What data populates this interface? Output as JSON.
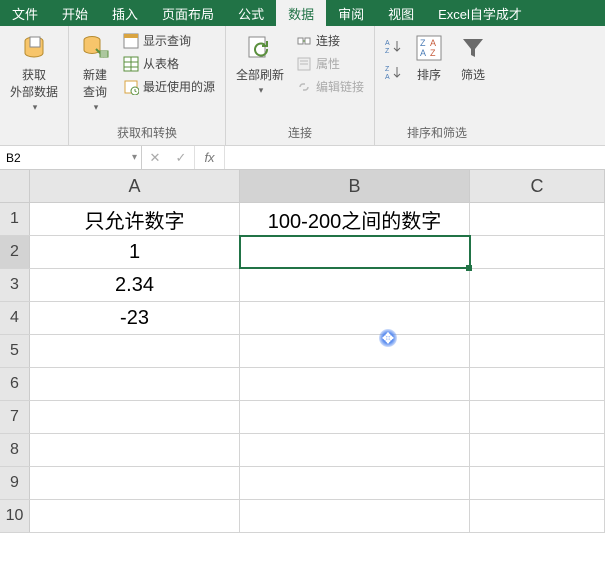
{
  "tabs": {
    "file": "文件",
    "home": "开始",
    "insert": "插入",
    "layout": "页面布局",
    "formulas": "公式",
    "data": "数据",
    "review": "审阅",
    "view": "视图",
    "custom": "Excel自学成才"
  },
  "ribbon": {
    "get_data": "获取\n外部数据",
    "new_query": "新建\n查询",
    "show_queries": "显示查询",
    "from_table": "从表格",
    "recent_sources": "最近使用的源",
    "group_transform": "获取和转换",
    "refresh_all": "全部刷新",
    "connections": "连接",
    "properties": "属性",
    "edit_links": "编辑链接",
    "group_conn": "连接",
    "sort_za": "排序",
    "filter": "筛选",
    "group_sort": "排序和筛选"
  },
  "namebox": "B2",
  "fx": "fx",
  "chart_data": {
    "type": "table",
    "columns": [
      "A",
      "B",
      "C"
    ],
    "rows": [
      {
        "A": "只允许数字",
        "B": "100-200之间的数字",
        "C": ""
      },
      {
        "A": "1",
        "B": "",
        "C": ""
      },
      {
        "A": "2.34",
        "B": "",
        "C": ""
      },
      {
        "A": "-23",
        "B": "",
        "C": ""
      },
      {
        "A": "",
        "B": "",
        "C": ""
      },
      {
        "A": "",
        "B": "",
        "C": ""
      },
      {
        "A": "",
        "B": "",
        "C": ""
      },
      {
        "A": "",
        "B": "",
        "C": ""
      },
      {
        "A": "",
        "B": "",
        "C": ""
      },
      {
        "A": "",
        "B": "",
        "C": ""
      }
    ],
    "selected_cell": "B2"
  }
}
